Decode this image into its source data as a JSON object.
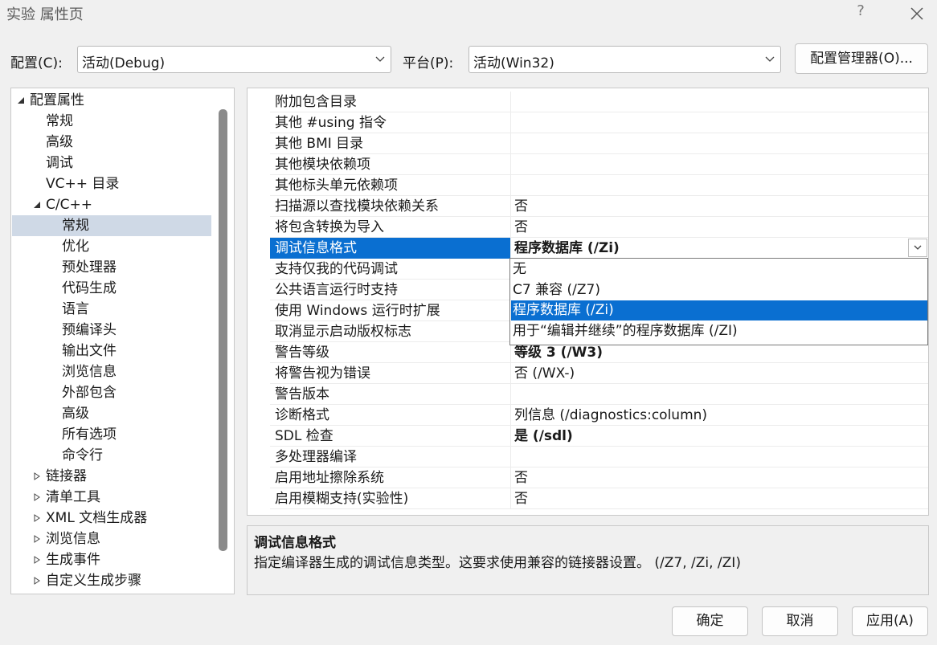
{
  "window": {
    "title": "实验 属性页",
    "help": "?"
  },
  "config_row": {
    "config_label": "配置(C):",
    "config_value": "活动(Debug)",
    "platform_label": "平台(P):",
    "platform_value": "活动(Win32)",
    "manager_button": "配置管理器(O)..."
  },
  "tree": [
    {
      "label": "配置属性",
      "level": 0,
      "expander": "expanded"
    },
    {
      "label": "常规",
      "level": 1,
      "expander": "none"
    },
    {
      "label": "高级",
      "level": 1,
      "expander": "none"
    },
    {
      "label": "调试",
      "level": 1,
      "expander": "none"
    },
    {
      "label": "VC++ 目录",
      "level": 1,
      "expander": "none"
    },
    {
      "label": "C/C++",
      "level": 1,
      "expander": "expanded"
    },
    {
      "label": "常规",
      "level": 2,
      "expander": "none",
      "selected": true
    },
    {
      "label": "优化",
      "level": 2,
      "expander": "none"
    },
    {
      "label": "预处理器",
      "level": 2,
      "expander": "none"
    },
    {
      "label": "代码生成",
      "level": 2,
      "expander": "none"
    },
    {
      "label": "语言",
      "level": 2,
      "expander": "none"
    },
    {
      "label": "预编译头",
      "level": 2,
      "expander": "none"
    },
    {
      "label": "输出文件",
      "level": 2,
      "expander": "none"
    },
    {
      "label": "浏览信息",
      "level": 2,
      "expander": "none"
    },
    {
      "label": "外部包含",
      "level": 2,
      "expander": "none"
    },
    {
      "label": "高级",
      "level": 2,
      "expander": "none"
    },
    {
      "label": "所有选项",
      "level": 2,
      "expander": "none"
    },
    {
      "label": "命令行",
      "level": 2,
      "expander": "none"
    },
    {
      "label": "链接器",
      "level": 1,
      "expander": "collapsed"
    },
    {
      "label": "清单工具",
      "level": 1,
      "expander": "collapsed"
    },
    {
      "label": "XML 文档生成器",
      "level": 1,
      "expander": "collapsed"
    },
    {
      "label": "浏览信息",
      "level": 1,
      "expander": "collapsed"
    },
    {
      "label": "生成事件",
      "level": 1,
      "expander": "collapsed"
    },
    {
      "label": "自定义生成步骤",
      "level": 1,
      "expander": "collapsed"
    }
  ],
  "properties": [
    {
      "name": "附加包含目录",
      "value": "",
      "bold": false
    },
    {
      "name": "其他 #using 指令",
      "value": "",
      "bold": false
    },
    {
      "name": "其他 BMI 目录",
      "value": "",
      "bold": false
    },
    {
      "name": "其他模块依赖项",
      "value": "",
      "bold": false
    },
    {
      "name": "其他标头单元依赖项",
      "value": "",
      "bold": false
    },
    {
      "name": "扫描源以查找模块依赖关系",
      "value": "否",
      "bold": false
    },
    {
      "name": "将包含转换为导入",
      "value": "否",
      "bold": false
    },
    {
      "name": "调试信息格式",
      "value": "程序数据库 (/Zi)",
      "bold": true,
      "selected": true
    },
    {
      "name": "支持仅我的代码调试",
      "value": "",
      "bold": false
    },
    {
      "name": "公共语言运行时支持",
      "value": "",
      "bold": false
    },
    {
      "name": "使用 Windows 运行时扩展",
      "value": "",
      "bold": false
    },
    {
      "name": "取消显示启动版权标志",
      "value": "",
      "bold": false
    },
    {
      "name": "警告等级",
      "value": "等级 3 (/W3)",
      "bold": true
    },
    {
      "name": "将警告视为错误",
      "value": "否 (/WX-)",
      "bold": false
    },
    {
      "name": "警告版本",
      "value": "",
      "bold": false
    },
    {
      "name": "诊断格式",
      "value": "列信息 (/diagnostics:column)",
      "bold": false
    },
    {
      "name": "SDL 检查",
      "value": "是 (/sdl)",
      "bold": true
    },
    {
      "name": "多处理器编译",
      "value": "",
      "bold": false
    },
    {
      "name": "启用地址擦除系统",
      "value": "否",
      "bold": false
    },
    {
      "name": "启用模糊支持(实验性)",
      "value": "否",
      "bold": false
    }
  ],
  "dropdown_options": [
    {
      "label": "无",
      "selected": false
    },
    {
      "label": "C7 兼容 (/Z7)",
      "selected": false
    },
    {
      "label": "程序数据库 (/Zi)",
      "selected": true
    },
    {
      "label": "用于“编辑并继续”的程序数据库 (/ZI)",
      "selected": false
    }
  ],
  "description": {
    "title": "调试信息格式",
    "text": "指定编译器生成的调试信息类型。这要求使用兼容的链接器设置。   (/Z7, /Zi, /ZI)"
  },
  "buttons": {
    "ok": "确定",
    "cancel": "取消",
    "apply": "应用(A)"
  },
  "colors": {
    "selection_blue": "#0a6fd1",
    "tree_selection": "#cfd9e6",
    "background": "#f0f0f0"
  },
  "icons": {
    "close": "close-icon",
    "dropdown": "chevron-down-icon",
    "tree_expanded": "triangle-expanded-icon",
    "tree_collapsed": "triangle-collapsed-icon"
  }
}
